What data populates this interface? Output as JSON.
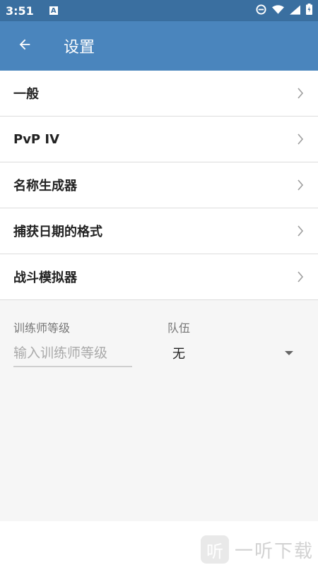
{
  "status_bar": {
    "time": "3:51",
    "notification_icon_letter": "A",
    "icons": [
      "do-not-disturb-icon",
      "wifi-icon",
      "signal-icon",
      "battery-icon"
    ]
  },
  "app_bar": {
    "title": "设置",
    "back_icon": "arrow-left-icon",
    "color": "#4a85bd"
  },
  "menu": {
    "items": [
      {
        "label": "一般"
      },
      {
        "label": "PvP IV"
      },
      {
        "label": "名称生成器"
      },
      {
        "label": "捕获日期的格式"
      },
      {
        "label": "战斗模拟器"
      }
    ],
    "chevron_icon": "chevron-right-icon"
  },
  "form": {
    "trainer_level_label": "训练师等级",
    "trainer_level_placeholder": "输入训练师等级",
    "trainer_level_value": "",
    "team_label": "队伍",
    "team_value": "无"
  },
  "watermark": {
    "logo_char": "听",
    "text": "一听下载"
  }
}
